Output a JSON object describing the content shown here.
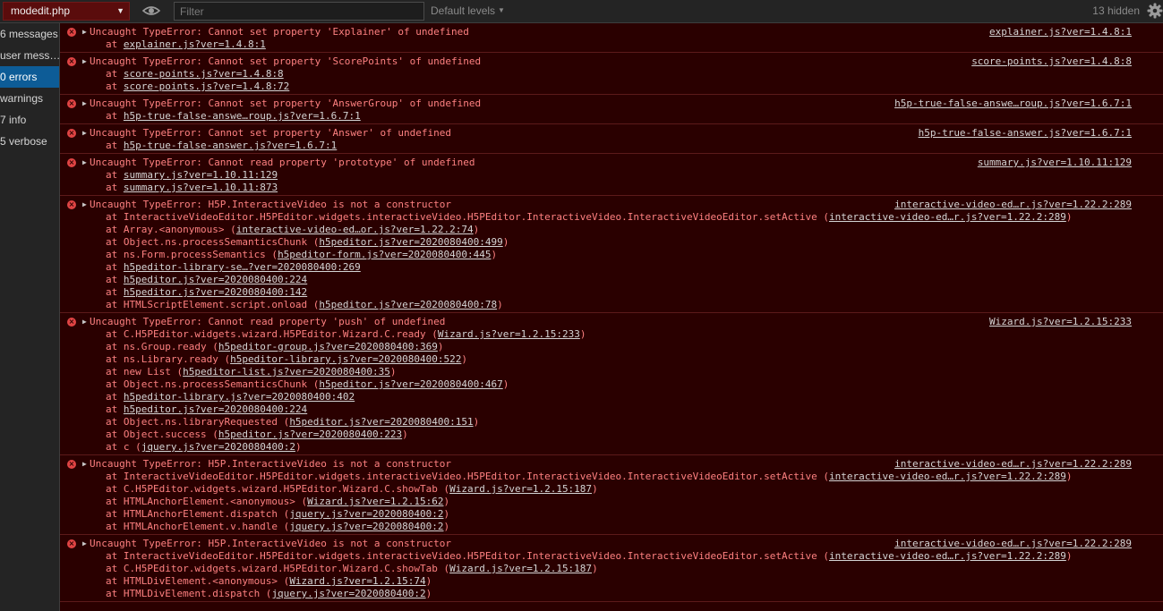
{
  "toolbar": {
    "context": "modedit.php",
    "filter_placeholder": "Filter",
    "levels": "Default levels",
    "hidden": "13 hidden"
  },
  "sidebar": {
    "items": [
      "6 messages",
      "user mess…",
      "0 errors",
      "warnings",
      "7 info",
      "5 verbose"
    ],
    "active_index": 2
  },
  "messages": [
    {
      "text": "Uncaught TypeError: Cannot set property 'Explainer' of undefined",
      "source": "explainer.js?ver=1.4.8:1",
      "frames": [
        {
          "prefix": "at ",
          "link": "explainer.js?ver=1.4.8:1"
        }
      ]
    },
    {
      "text": "Uncaught TypeError: Cannot set property 'ScorePoints' of undefined",
      "source": "score-points.js?ver=1.4.8:8",
      "frames": [
        {
          "prefix": "at ",
          "link": "score-points.js?ver=1.4.8:8"
        },
        {
          "prefix": "at ",
          "link": "score-points.js?ver=1.4.8:72"
        }
      ]
    },
    {
      "text": "Uncaught TypeError: Cannot set property 'AnswerGroup' of undefined",
      "source": "h5p-true-false-answe…roup.js?ver=1.6.7:1",
      "frames": [
        {
          "prefix": "at ",
          "link": "h5p-true-false-answe…roup.js?ver=1.6.7:1"
        }
      ]
    },
    {
      "text": "Uncaught TypeError: Cannot set property 'Answer' of undefined",
      "source": "h5p-true-false-answer.js?ver=1.6.7:1",
      "frames": [
        {
          "prefix": "at ",
          "link": "h5p-true-false-answer.js?ver=1.6.7:1"
        }
      ]
    },
    {
      "text": "Uncaught TypeError: Cannot read property 'prototype' of undefined",
      "source": "summary.js?ver=1.10.11:129",
      "frames": [
        {
          "prefix": "at ",
          "link": "summary.js?ver=1.10.11:129"
        },
        {
          "prefix": "at ",
          "link": "summary.js?ver=1.10.11:873"
        }
      ]
    },
    {
      "text": "Uncaught TypeError: H5P.InteractiveVideo is not a constructor",
      "source": "interactive-video-ed…r.js?ver=1.22.2:289",
      "frames": [
        {
          "prefix": "at InteractiveVideoEditor.H5PEditor.widgets.interactiveVideo.H5PEditor.InteractiveVideo.InteractiveVideoEditor.setActive (",
          "link": "interactive-video-ed…r.js?ver=1.22.2:289",
          "suffix": ")"
        },
        {
          "prefix": "at Array.<anonymous> (",
          "link": "interactive-video-ed…or.js?ver=1.22.2:74",
          "suffix": ")"
        },
        {
          "prefix": "at Object.ns.processSemanticsChunk (",
          "link": "h5peditor.js?ver=2020080400:499",
          "suffix": ")"
        },
        {
          "prefix": "at ns.Form.processSemantics (",
          "link": "h5peditor-form.js?ver=2020080400:445",
          "suffix": ")"
        },
        {
          "prefix": "at ",
          "link": "h5peditor-library-se…?ver=2020080400:269"
        },
        {
          "prefix": "at ",
          "link": "h5peditor.js?ver=2020080400:224"
        },
        {
          "prefix": "at ",
          "link": "h5peditor.js?ver=2020080400:142"
        },
        {
          "prefix": "at HTMLScriptElement.script.onload (",
          "link": "h5peditor.js?ver=2020080400:78",
          "suffix": ")"
        }
      ]
    },
    {
      "text": "Uncaught TypeError: Cannot read property 'push' of undefined",
      "source": "Wizard.js?ver=1.2.15:233",
      "frames": [
        {
          "prefix": "at C.H5PEditor.widgets.wizard.H5PEditor.Wizard.C.ready (",
          "link": "Wizard.js?ver=1.2.15:233",
          "suffix": ")"
        },
        {
          "prefix": "at ns.Group.ready (",
          "link": "h5peditor-group.js?ver=2020080400:369",
          "suffix": ")"
        },
        {
          "prefix": "at ns.Library.ready (",
          "link": "h5peditor-library.js?ver=2020080400:522",
          "suffix": ")"
        },
        {
          "prefix": "at new List (",
          "link": "h5peditor-list.js?ver=2020080400:35",
          "suffix": ")"
        },
        {
          "prefix": "at Object.ns.processSemanticsChunk (",
          "link": "h5peditor.js?ver=2020080400:467",
          "suffix": ")"
        },
        {
          "prefix": "at ",
          "link": "h5peditor-library.js?ver=2020080400:402"
        },
        {
          "prefix": "at ",
          "link": "h5peditor.js?ver=2020080400:224"
        },
        {
          "prefix": "at Object.ns.libraryRequested (",
          "link": "h5peditor.js?ver=2020080400:151",
          "suffix": ")"
        },
        {
          "prefix": "at Object.success (",
          "link": "h5peditor.js?ver=2020080400:223",
          "suffix": ")"
        },
        {
          "prefix": "at c (",
          "link": "jquery.js?ver=2020080400:2",
          "suffix": ")"
        }
      ]
    },
    {
      "text": "Uncaught TypeError: H5P.InteractiveVideo is not a constructor",
      "source": "interactive-video-ed…r.js?ver=1.22.2:289",
      "frames": [
        {
          "prefix": "at InteractiveVideoEditor.H5PEditor.widgets.interactiveVideo.H5PEditor.InteractiveVideo.InteractiveVideoEditor.setActive (",
          "link": "interactive-video-ed…r.js?ver=1.22.2:289",
          "suffix": ")"
        },
        {
          "prefix": "at C.H5PEditor.widgets.wizard.H5PEditor.Wizard.C.showTab (",
          "link": "Wizard.js?ver=1.2.15:187",
          "suffix": ")"
        },
        {
          "prefix": "at HTMLAnchorElement.<anonymous> (",
          "link": "Wizard.js?ver=1.2.15:62",
          "suffix": ")"
        },
        {
          "prefix": "at HTMLAnchorElement.dispatch (",
          "link": "jquery.js?ver=2020080400:2",
          "suffix": ")"
        },
        {
          "prefix": "at HTMLAnchorElement.v.handle (",
          "link": "jquery.js?ver=2020080400:2",
          "suffix": ")"
        }
      ]
    },
    {
      "text": "Uncaught TypeError: H5P.InteractiveVideo is not a constructor",
      "source": "interactive-video-ed…r.js?ver=1.22.2:289",
      "frames": [
        {
          "prefix": "at InteractiveVideoEditor.H5PEditor.widgets.interactiveVideo.H5PEditor.InteractiveVideo.InteractiveVideoEditor.setActive (",
          "link": "interactive-video-ed…r.js?ver=1.22.2:289",
          "suffix": ")"
        },
        {
          "prefix": "at C.H5PEditor.widgets.wizard.H5PEditor.Wizard.C.showTab (",
          "link": "Wizard.js?ver=1.2.15:187",
          "suffix": ")"
        },
        {
          "prefix": "at HTMLDivElement.<anonymous> (",
          "link": "Wizard.js?ver=1.2.15:74",
          "suffix": ")"
        },
        {
          "prefix": "at HTMLDivElement.dispatch (",
          "link": "jquery.js?ver=2020080400:2",
          "suffix": ")"
        }
      ]
    }
  ]
}
